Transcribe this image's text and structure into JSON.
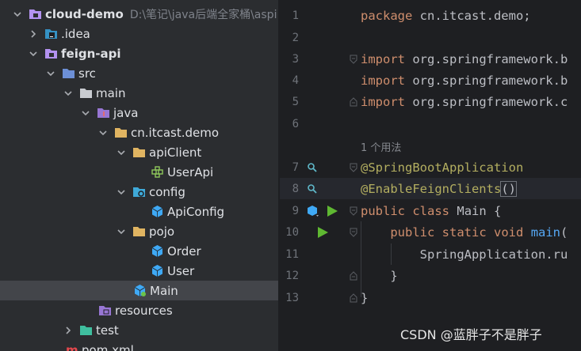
{
  "project_tree": {
    "root": {
      "name": "cloud-demo",
      "path": "D:\\笔记\\java后端全家桶\\aspi"
    },
    "items": [
      {
        "label": "cloud-demo",
        "expanded": true,
        "icon": "module-folder-icon"
      },
      {
        "label": ".idea",
        "expanded": false,
        "icon": "idea-folder-icon"
      },
      {
        "label": "feign-api",
        "expanded": true,
        "icon": "module-folder-icon"
      },
      {
        "label": "src",
        "expanded": true,
        "icon": "source-folder-icon"
      },
      {
        "label": "main",
        "expanded": true,
        "icon": "folder-icon"
      },
      {
        "label": "java",
        "expanded": true,
        "icon": "java-source-root-icon"
      },
      {
        "label": "cn.itcast.demo",
        "expanded": true,
        "icon": "package-icon"
      },
      {
        "label": "apiClient",
        "expanded": true,
        "icon": "package-icon"
      },
      {
        "label": "UserApi",
        "icon": "feign-interface-icon"
      },
      {
        "label": "config",
        "expanded": true,
        "icon": "config-package-icon"
      },
      {
        "label": "ApiConfig",
        "icon": "class-icon"
      },
      {
        "label": "pojo",
        "expanded": true,
        "icon": "package-icon"
      },
      {
        "label": "Order",
        "icon": "class-icon"
      },
      {
        "label": "User",
        "icon": "class-icon"
      },
      {
        "label": "Main",
        "icon": "spring-boot-class-icon",
        "selected": true
      },
      {
        "label": "resources",
        "icon": "resources-folder-icon"
      },
      {
        "label": "test",
        "expanded": false,
        "icon": "test-folder-icon"
      },
      {
        "label": "pom.xml",
        "icon": "maven-icon"
      }
    ]
  },
  "editor": {
    "line_numbers": [
      "1",
      "2",
      "3",
      "4",
      "5",
      "6",
      "7",
      "8",
      "9",
      "10",
      "11",
      "12",
      "13"
    ],
    "usage_hint": "1 个用法",
    "lines": {
      "l1": {
        "kw": "package",
        "rest": " cn.itcast.demo;"
      },
      "l3": {
        "kw": "import",
        "rest": " org.springframework.b"
      },
      "l4": {
        "kw": "import",
        "rest": " org.springframework.b"
      },
      "l5": {
        "kw": "import",
        "rest": " org.springframework.c"
      },
      "l7": {
        "ann": "@SpringBootApplication"
      },
      "l8": {
        "ann": "@EnableFeignClients",
        "rest": "()"
      },
      "l9": {
        "kw1": "public",
        "kw2": "class",
        "name": "Main",
        "rest": " {"
      },
      "l10": {
        "kw1": "public",
        "kw2": "static",
        "kw3": "void",
        "fn": "main",
        "rest": "("
      },
      "l11": {
        "text": "SpringApplication.ru"
      },
      "l12": {
        "text": "}"
      },
      "l13": {
        "text": "}"
      }
    }
  },
  "watermark": "CSDN @蓝胖子不是胖子",
  "colors": {
    "panel_bg": "#2b2d30",
    "editor_bg": "#1e1f22",
    "selection": "#43454a",
    "keyword": "#cf8e6d",
    "annotation": "#b3ae60",
    "method": "#56a8f5",
    "run_green": "#5fb832"
  }
}
